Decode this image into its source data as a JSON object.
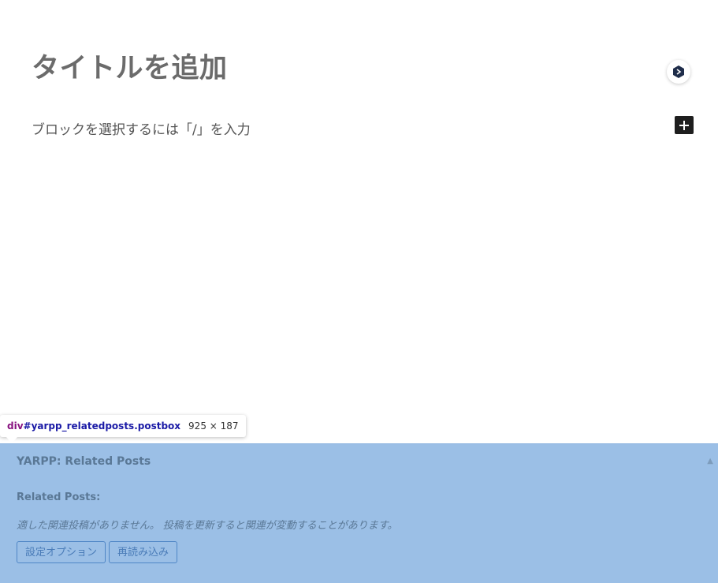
{
  "editor": {
    "title_placeholder": "タイトルを追加",
    "block_placeholder": "ブロックを選択するには「/」を入力",
    "extension_icon": "hexagon-arrow-icon",
    "add_block_icon": "plus-icon"
  },
  "inspector": {
    "tag": "div",
    "selector": "#yarpp_relatedposts.postbox",
    "dimensions": "925 × 187"
  },
  "metabox": {
    "title": "YARPP: Related Posts",
    "toggle_icon": "triangle-up-icon",
    "related_label": "Related Posts:",
    "empty_message": "適した関連投稿がありません。 投稿を更新すると関連が変動することがあります。",
    "settings_button": "設定オプション",
    "reload_button": "再読み込み"
  },
  "colors": {
    "highlight": "#9bbfe6",
    "button_border": "#4f86c6"
  }
}
